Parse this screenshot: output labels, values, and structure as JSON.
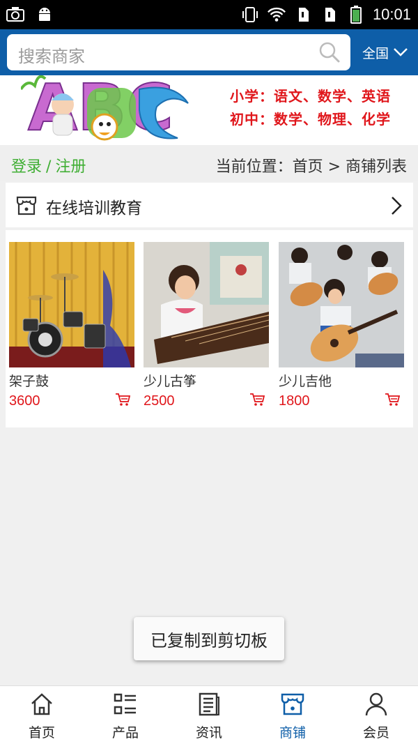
{
  "status_bar": {
    "time": "10:01"
  },
  "header": {
    "search_placeholder": "搜索商家",
    "region_label": "全国",
    "accent_color": "#0e5ea8"
  },
  "banner": {
    "line1": "小学：语文、数学、英语",
    "line2": "初中：数学、物理、化学",
    "art_letters": "ABC"
  },
  "breadcrumb": {
    "login": "登录",
    "separator": "/",
    "register": "注册",
    "location": "当前位置：首页 > 商铺列表"
  },
  "shop": {
    "title": "在线培训教育"
  },
  "products": [
    {
      "name": "架子鼓",
      "price": "3600"
    },
    {
      "name": "少儿古筝",
      "price": "2500"
    },
    {
      "name": "少儿吉他",
      "price": "1800"
    }
  ],
  "toast": {
    "message": "已复制到剪切板"
  },
  "bottom_nav": [
    {
      "label": "首页",
      "icon": "home-icon"
    },
    {
      "label": "产品",
      "icon": "product-list-icon"
    },
    {
      "label": "资讯",
      "icon": "news-icon"
    },
    {
      "label": "商铺",
      "icon": "shop-icon",
      "active": true
    },
    {
      "label": "会员",
      "icon": "user-icon"
    }
  ]
}
